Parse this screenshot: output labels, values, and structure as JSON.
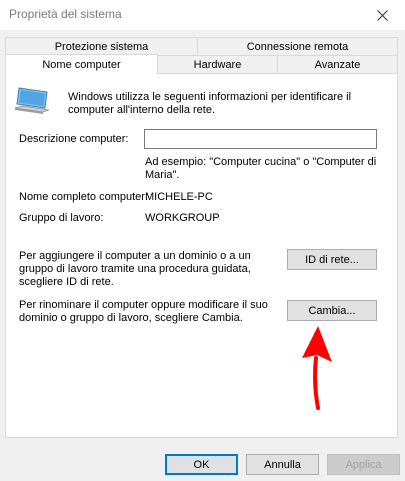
{
  "window": {
    "title": "Proprietà del sistema"
  },
  "tabs": {
    "row1": [
      {
        "label": "Protezione sistema"
      },
      {
        "label": "Connessione remota"
      }
    ],
    "row2": [
      {
        "label": "Nome computer",
        "active": true
      },
      {
        "label": "Hardware"
      },
      {
        "label": "Avanzate"
      }
    ]
  },
  "panel": {
    "intro_line1": "Windows utilizza le seguenti informazioni per identificare il",
    "intro_line2": "computer all'interno della rete.",
    "description_label": "Descrizione computer:",
    "description_value": "",
    "example_line1": "Ad esempio: \"Computer cucina\" o \"Computer di",
    "example_line2": "Maria\".",
    "fullname_label": "Nome completo computer:",
    "fullname_value": "MICHELE-PC",
    "workgroup_label": "Gruppo di lavoro:",
    "workgroup_value": "WORKGROUP",
    "network_text_line1": "Per aggiungere il computer a un dominio o a un",
    "network_text_line2": "gruppo di lavoro tramite una procedura guidata,",
    "network_text_line3": "scegliere ID di rete.",
    "network_id_button": "ID di rete...",
    "rename_text_line1": "Per rinominare il computer oppure modificare il suo",
    "rename_text_line2": "dominio o gruppo di lavoro, scegliere Cambia.",
    "change_button": "Cambia..."
  },
  "footer": {
    "ok": "OK",
    "cancel": "Annulla",
    "apply": "Applica"
  },
  "colors": {
    "annotation_arrow": "#ff0000",
    "accent_border": "#0078d7"
  },
  "icons": {
    "computer": "computer-monitor-icon",
    "close": "close-icon"
  }
}
